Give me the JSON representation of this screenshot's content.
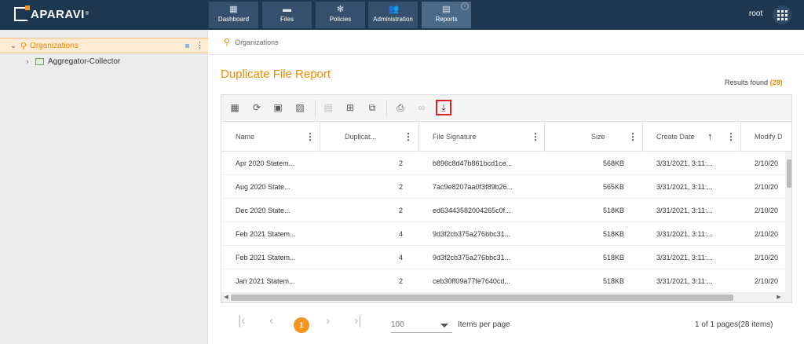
{
  "app": {
    "brand": "APARAVI",
    "trademark": "®"
  },
  "nav": [
    {
      "label": "Dashboard",
      "icon": "dashboard-icon"
    },
    {
      "label": "Files",
      "icon": "folder-icon"
    },
    {
      "label": "Policies",
      "icon": "gear-icon"
    },
    {
      "label": "Administration",
      "icon": "users-icon"
    },
    {
      "label": "Reports",
      "icon": "clipboard-icon",
      "active": true
    }
  ],
  "user": {
    "name": "root"
  },
  "sidebar": {
    "items": [
      {
        "label": "Organizations",
        "selected": true,
        "icon": "organization-icon"
      },
      {
        "label": "Aggregator-Collector",
        "icon": "aggregator-icon"
      }
    ]
  },
  "breadcrumb": {
    "label": "Organizations"
  },
  "page": {
    "title": "Duplicate File Report",
    "results_label": "Results found",
    "results_count": "(28)"
  },
  "table": {
    "columns": [
      "Name",
      "Duplicat...",
      "File Signature",
      "Size",
      "Create Date",
      "Modify D"
    ],
    "rows": [
      [
        "Apr 2020 Statem...",
        "2",
        "b896c8d47b861bcd1ce...",
        "568KB",
        "3/31/2021, 3:11:...",
        "2/10/20"
      ],
      [
        "Aug 2020 State...",
        "2",
        "7ac9e8207aa0f3f89b26...",
        "565KB",
        "3/31/2021, 3:11:...",
        "2/10/20"
      ],
      [
        "Dec 2020 State...",
        "2",
        "ed63443582004265c0f...",
        "518KB",
        "3/31/2021, 3:11:...",
        "2/10/20"
      ],
      [
        "Feb 2021 Statem...",
        "4",
        "9d3f2cb375a276bbc31...",
        "518KB",
        "3/31/2021, 3:11:...",
        "2/10/20"
      ],
      [
        "Feb 2021 Statem...",
        "4",
        "9d3f2cb375a276bbc31...",
        "518KB",
        "3/31/2021, 3:11:...",
        "2/10/20"
      ],
      [
        "Jan 2021 Statem...",
        "2",
        "ceb30ff09a77fe7640cd...",
        "518KB",
        "3/31/2021, 3:11:...",
        "2/10/20"
      ]
    ]
  },
  "pager": {
    "current_page": "1",
    "per_page": "100",
    "per_page_label": "Items per page",
    "info": "1 of 1 pages(28 items)"
  },
  "colors": {
    "accent": "#f08a00",
    "topbar": "#1d3751",
    "highlight_box": "#e02020"
  }
}
